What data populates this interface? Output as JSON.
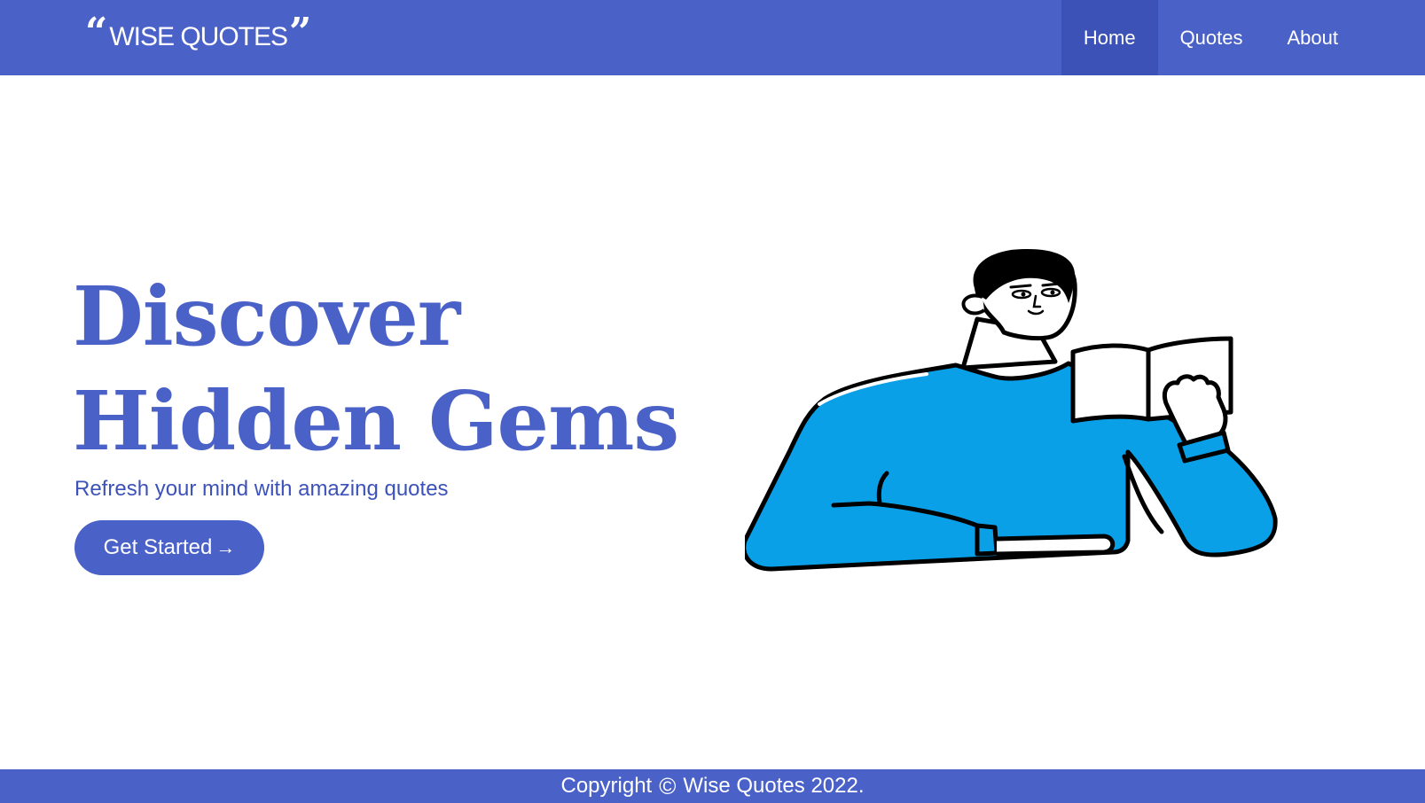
{
  "brand": {
    "open_quote": "“",
    "name": "WISE QUOTES",
    "close_quote": "”"
  },
  "nav": {
    "items": [
      {
        "label": "Home",
        "active": true
      },
      {
        "label": "Quotes",
        "active": false
      },
      {
        "label": "About",
        "active": false
      }
    ]
  },
  "hero": {
    "title_line1": "Discover",
    "title_line2": "Hidden Gems",
    "subtitle": "Refresh your mind with amazing quotes",
    "cta_label": "Get Started",
    "cta_icon": "arrow-right-icon",
    "illustration": "man-reading-book-illustration"
  },
  "footer": {
    "prefix": "Copyright",
    "icon": "copyright-icon",
    "suffix": "Wise Quotes 2022."
  },
  "colors": {
    "primary": "#4a61c8",
    "nav_active": "#3c52b6",
    "sweater": "#0aa0e8",
    "text_on_primary": "#ffffff"
  }
}
